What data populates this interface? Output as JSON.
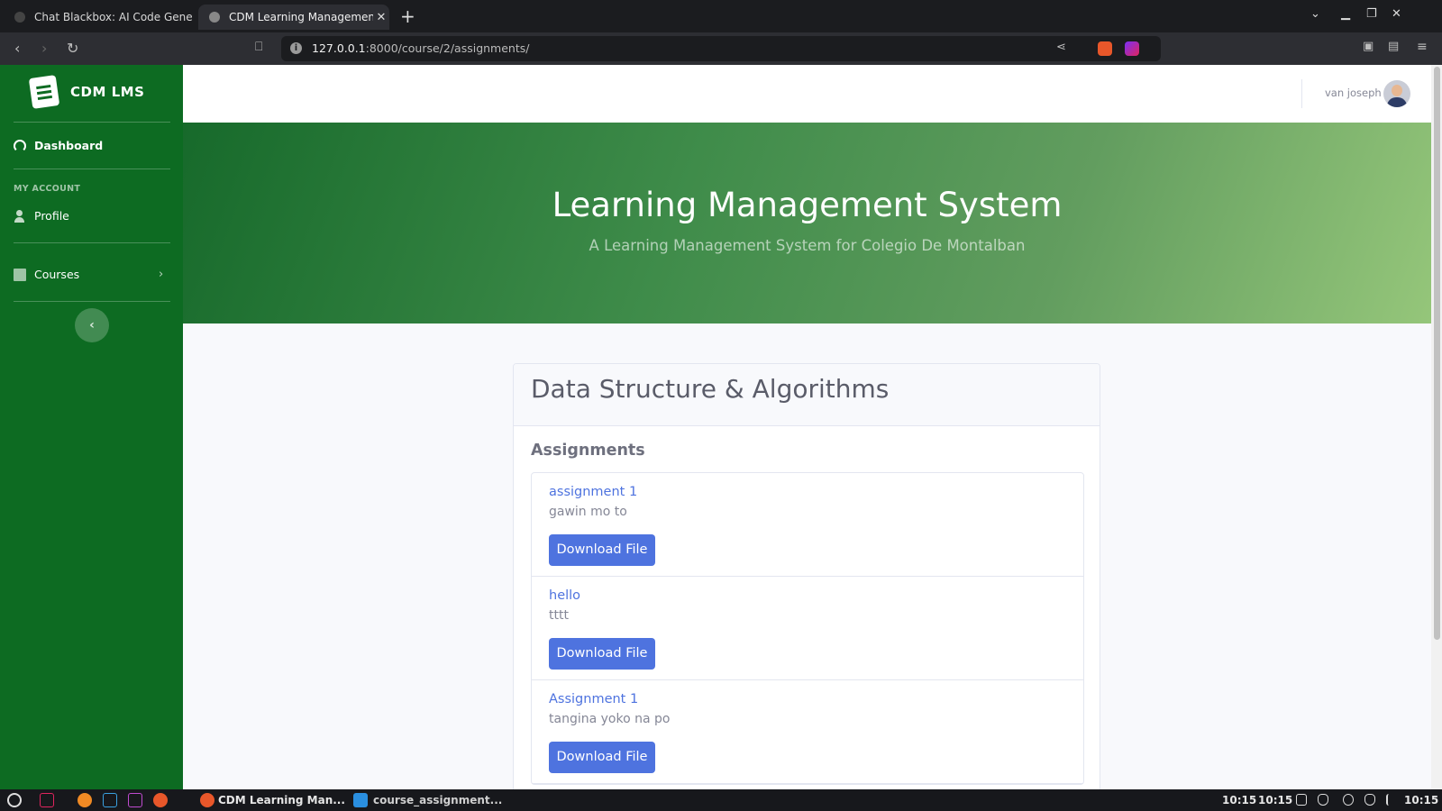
{
  "browser": {
    "tabs": [
      {
        "title": "Chat Blackbox: AI Code Generatio",
        "active": false
      },
      {
        "title": "CDM Learning Management S",
        "active": true
      }
    ],
    "url_host": "127.0.0.1",
    "url_path": ":8000/course/2/assignments/"
  },
  "sidebar": {
    "brand": "CDM LMS",
    "dashboard_label": "Dashboard",
    "account_heading": "MY ACCOUNT",
    "profile_label": "Profile",
    "courses_label": "Courses"
  },
  "topbar": {
    "username": "van joseph"
  },
  "hero": {
    "title": "Learning Management System",
    "subtitle": "A Learning Management System for Colegio De Montalban"
  },
  "course": {
    "title": "Data Structure & Algorithms",
    "section_title": "Assignments",
    "assignments": [
      {
        "title": "assignment 1",
        "description": "gawin mo to",
        "button": "Download File"
      },
      {
        "title": "hello",
        "description": "tttt",
        "button": "Download File"
      },
      {
        "title": "Assignment 1",
        "description": "tangina yoko na po",
        "button": "Download File"
      }
    ]
  },
  "taskbar": {
    "apps": [
      {
        "label": "CDM Learning Man..."
      },
      {
        "label": "course_assignment..."
      }
    ],
    "clock": "10:15"
  },
  "colors": {
    "sidebar": "#0d6b22",
    "primary": "#4e73df",
    "link": "#4e73df"
  }
}
